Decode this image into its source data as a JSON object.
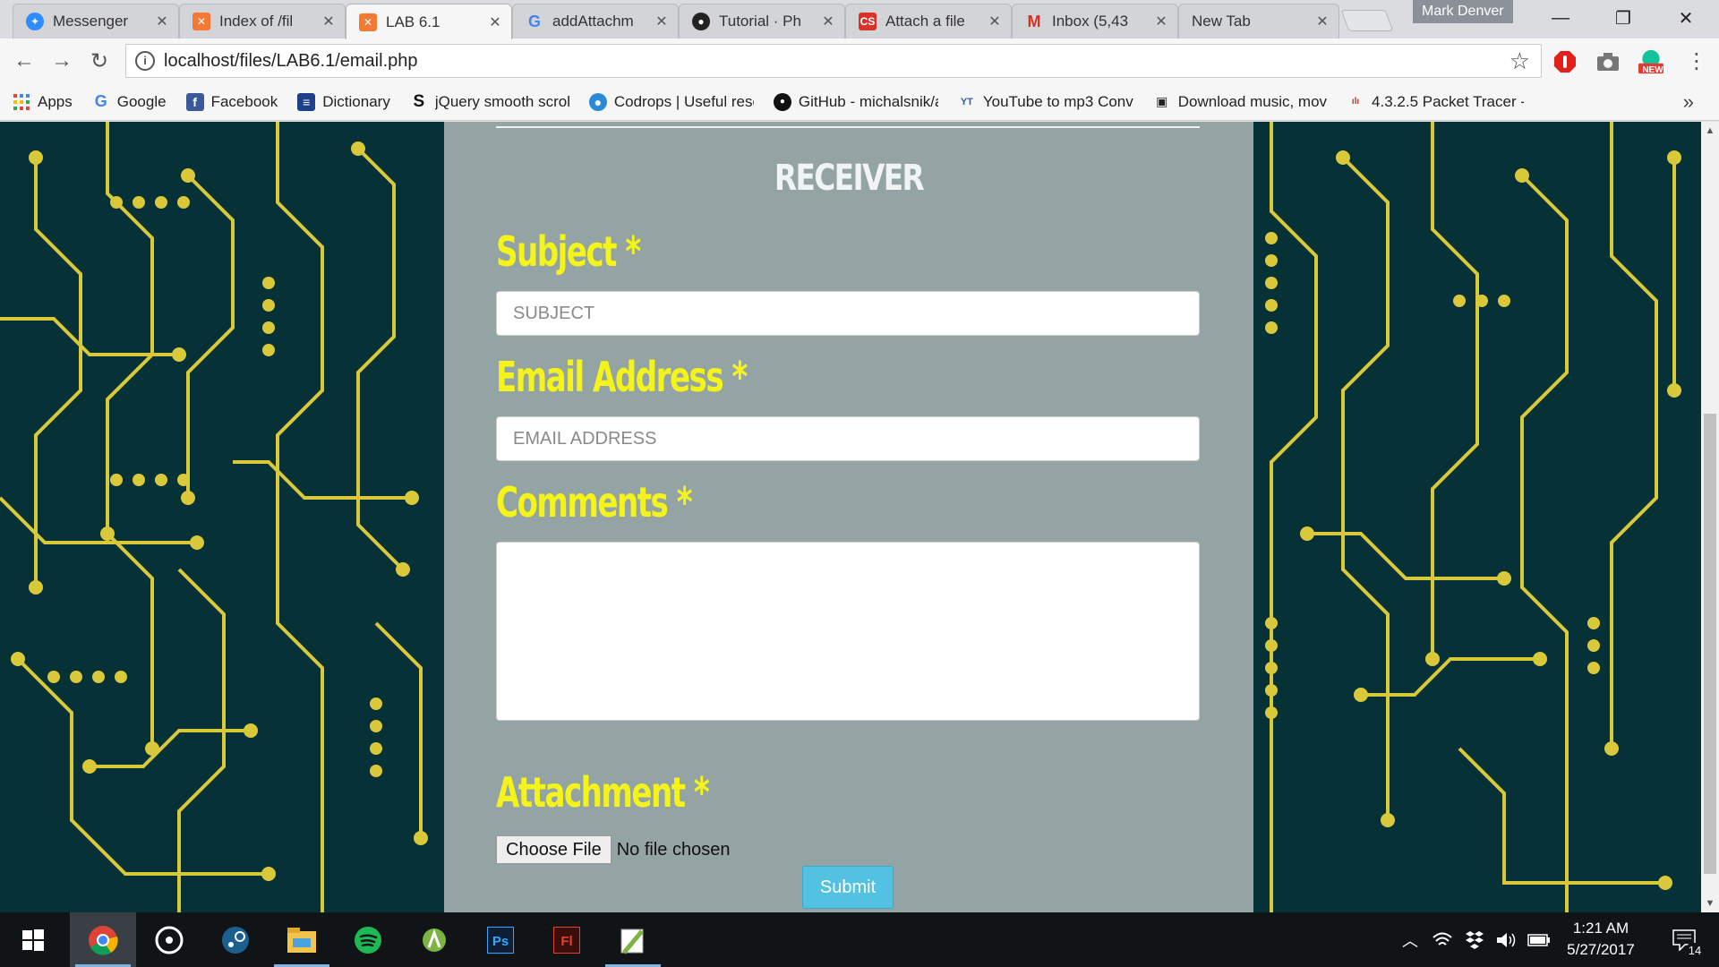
{
  "browser": {
    "tabs": [
      {
        "label": "Messenger",
        "favicon": "messenger-icon",
        "color": "#2d8cff"
      },
      {
        "label": "Index of /fil",
        "favicon": "xampp-icon",
        "color": "#f47a33"
      },
      {
        "label": "LAB 6.1",
        "favicon": "xampp-icon",
        "color": "#f47a33",
        "active": true
      },
      {
        "label": "addAttachm",
        "favicon": "google-icon",
        "color": "#4285f4"
      },
      {
        "label": "Tutorial · Ph",
        "favicon": "github-icon",
        "color": "#222"
      },
      {
        "label": "Attach a file",
        "favicon": "cs-icon",
        "color": "#d9322b"
      },
      {
        "label": "Inbox (5,43",
        "favicon": "gmail-icon",
        "color": "#d93025"
      },
      {
        "label": "New Tab",
        "favicon": "",
        "color": ""
      }
    ],
    "profile_name": "Mark Denver",
    "url": "localhost/files/LAB6.1/email.php",
    "ext_badge": "NEW",
    "bookmarks": [
      {
        "label": "Apps",
        "icon": "apps-grid-icon",
        "color": "#4285f4"
      },
      {
        "label": "Google",
        "icon": "google-icon",
        "color": "#4285f4"
      },
      {
        "label": "Facebook",
        "icon": "facebook-icon",
        "color": "#3b5998"
      },
      {
        "label": "Dictionary",
        "icon": "dictionary-icon",
        "color": "#1e3f8a"
      },
      {
        "label": "jQuery smooth scrolli",
        "icon": "s-icon",
        "color": "#111"
      },
      {
        "label": "Codrops | Useful reso",
        "icon": "codrops-icon",
        "color": "#2b8ad8"
      },
      {
        "label": "GitHub - michalsnik/a",
        "icon": "github-icon",
        "color": "#111"
      },
      {
        "label": "YouTube to mp3 Conv",
        "icon": "yt-mp3-icon",
        "color": "#2e5fb7"
      },
      {
        "label": "Download music, mov",
        "icon": "download-icon",
        "color": "#222"
      },
      {
        "label": "4.3.2.5 Packet Tracer -",
        "icon": "cisco-icon",
        "color": "#c0392b"
      }
    ]
  },
  "form": {
    "heading": "RECEIVER",
    "subject_label": "Subject *",
    "subject_placeholder": "SUBJECT",
    "email_label": "Email Address *",
    "email_placeholder": "EMAIL ADDRESS",
    "comments_label": "Comments *",
    "attachment_label": "Attachment *",
    "choose_file": "Choose File",
    "file_status": "No file chosen",
    "submit": "Submit"
  },
  "colors": {
    "label_yellow": "#f5f41a",
    "panel": "#94a4a4",
    "circuit_bg": "#053137",
    "circuit_trace": "#d8c83a",
    "submit_bg": "#53c2e2"
  },
  "taskbar": {
    "apps": [
      "windows-start-icon",
      "chrome-icon",
      "groove-icon",
      "steam-icon",
      "file-explorer-icon",
      "spotify-icon",
      "android-studio-icon",
      "photoshop-icon",
      "flash-icon",
      "notepad-plus-icon"
    ],
    "time": "1:21 AM",
    "date": "5/27/2017",
    "notifications": "14"
  }
}
